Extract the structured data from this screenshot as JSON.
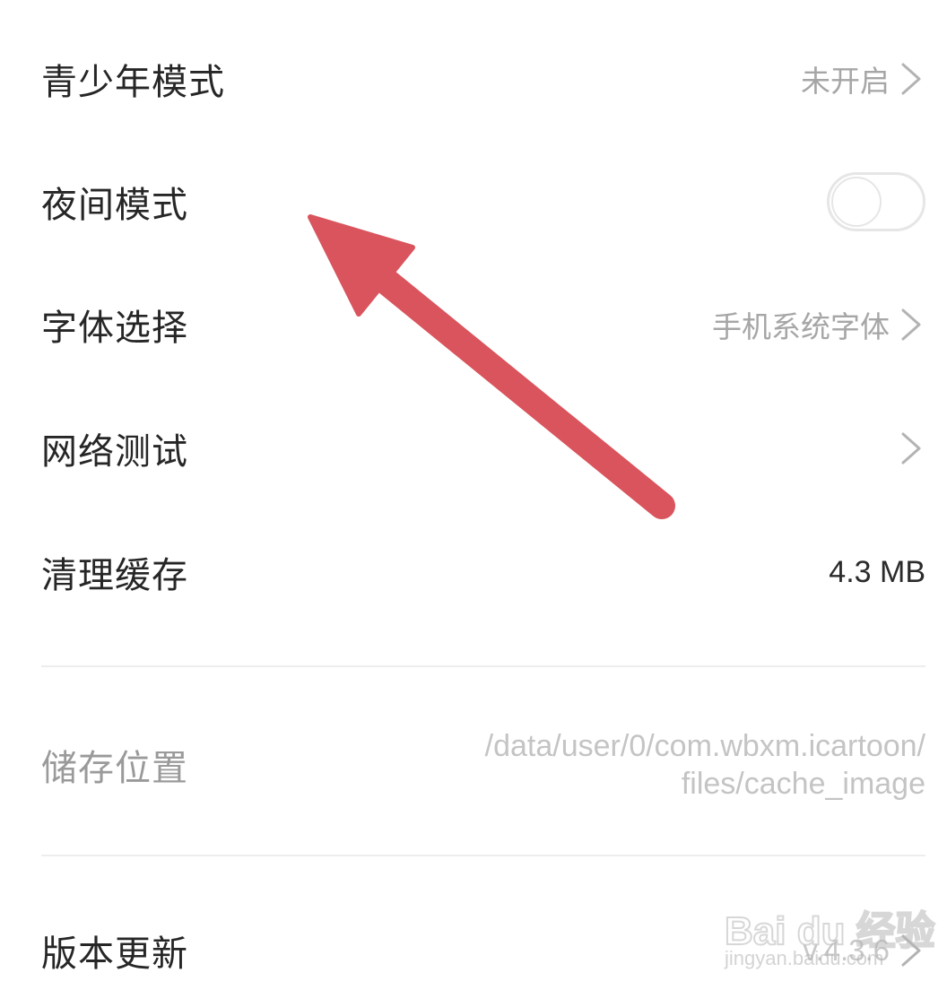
{
  "settings": {
    "teen_mode": {
      "label": "青少年模式",
      "value": "未开启"
    },
    "night_mode": {
      "label": "夜间模式",
      "enabled": false
    },
    "font": {
      "label": "字体选择",
      "value": "手机系统字体"
    },
    "network_test": {
      "label": "网络测试"
    },
    "clear_cache": {
      "label": "清理缓存",
      "value": "4.3 MB"
    },
    "storage": {
      "label": "储存位置",
      "path_line1": "/data/user/0/com.wbxm.icartoon/",
      "path_line2": "files/cache_image"
    },
    "version": {
      "label": "版本更新",
      "value": "v.4.3.6"
    }
  },
  "watermark": {
    "brand": "Bai du 经验",
    "url": "jingyan.baidu.com"
  },
  "colors": {
    "annotation_arrow": "#d9545c",
    "divider": "#ededed",
    "muted_text": "#a6a6a6"
  },
  "icons": {
    "chevron": "chevron-right-icon",
    "arrow": "annotation-arrow-icon"
  }
}
